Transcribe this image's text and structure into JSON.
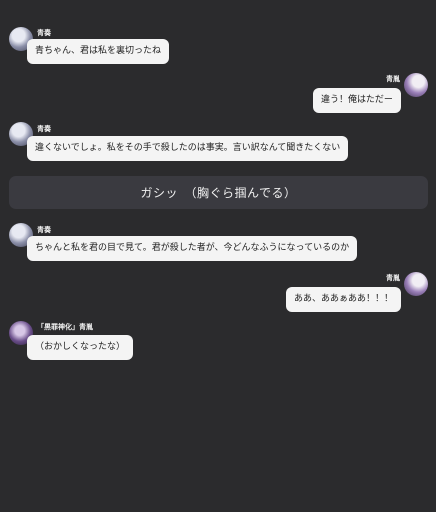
{
  "messages": [
    {
      "speaker": "青奏",
      "text": "青ちゃん、君は私を裏切ったね"
    },
    {
      "speaker": "青胤",
      "text": "違う！俺はただー"
    },
    {
      "speaker": "青奏",
      "text": "違くないでしょ。私をその手で殺したのは事実。言い訳なんて聞きたくない"
    },
    {
      "speaker": "青奏",
      "text": "ちゃんと私を君の目で見て。君が殺した者が、今どんなふうになっているのか"
    },
    {
      "speaker": "青胤",
      "text": "ああ、ああぁああ！！！"
    },
    {
      "speaker": "「黒罪神化」青胤",
      "text": "（おかしくなったな）"
    }
  ],
  "narration": "ガシッ　（胸ぐら掴んでる）"
}
